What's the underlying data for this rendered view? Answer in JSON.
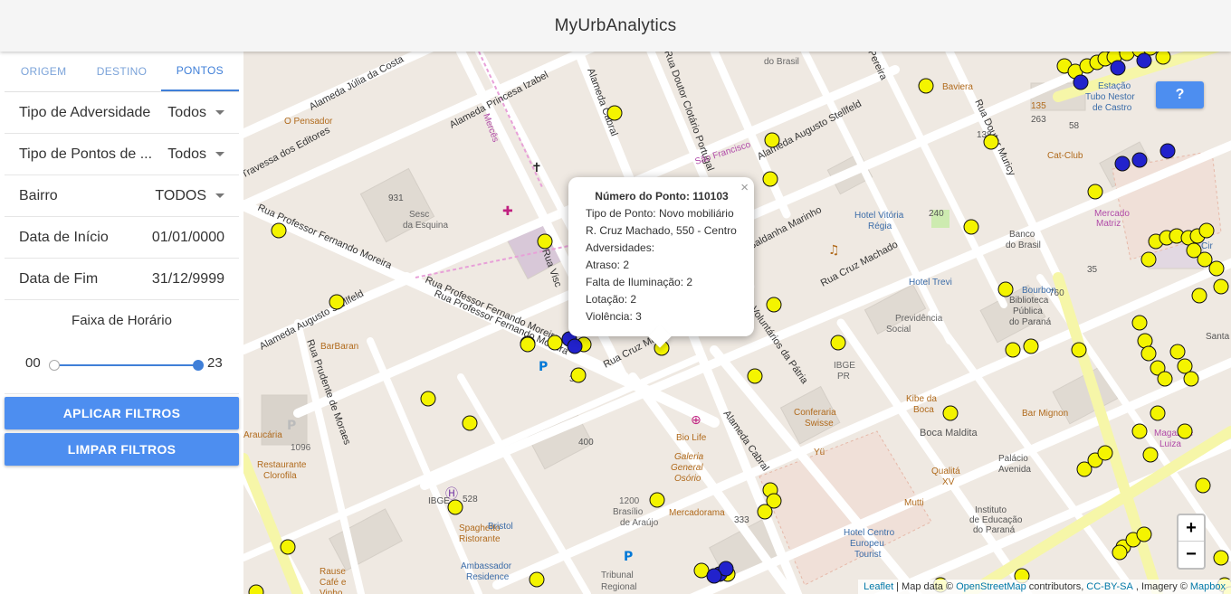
{
  "app": {
    "title": "MyUrbAnalytics"
  },
  "tabs": [
    {
      "label": "ORIGEM",
      "active": false
    },
    {
      "label": "DESTINO",
      "active": false
    },
    {
      "label": "PONTOS",
      "active": true
    }
  ],
  "filters": [
    {
      "label": "Tipo de Adversidade",
      "value": "Todos",
      "dropdown": true
    },
    {
      "label": "Tipo de Pontos de ...",
      "value": "Todos",
      "dropdown": true
    },
    {
      "label": "Bairro",
      "value": "TODOS",
      "dropdown": true
    },
    {
      "label": "Data de Início",
      "value": "01/01/0000",
      "dropdown": false
    },
    {
      "label": "Data de Fim",
      "value": "31/12/9999",
      "dropdown": false
    }
  ],
  "time_range": {
    "title": "Faixa de Horário",
    "min_label": "00",
    "max_label": "23",
    "min": 0,
    "max": 23
  },
  "buttons": {
    "apply": "APLICAR FILTROS",
    "clear": "LIMPAR FILTROS"
  },
  "popup": {
    "heading_label": "Número do Ponto:",
    "heading_value": "110103",
    "lines": [
      "Tipo de Ponto: Novo mobiliário",
      "R. Cruz Machado, 550 - Centro",
      "Adversidades:",
      "Atraso: 2",
      "Falta de Iluminação: 2",
      "Lotação: 2",
      "Violência: 3"
    ],
    "close": "×"
  },
  "help_button": "?",
  "zoom": {
    "in": "+",
    "out": "−"
  },
  "attribution": {
    "leaflet": "Leaflet",
    "sep1": "| Map data ©",
    "osm": "OpenStreetMap",
    "contrib": "contributors,",
    "license": "CC-BY-SA",
    "imagery": ", Imagery ©",
    "mapbox": "Mapbox"
  },
  "colors": {
    "primary": "#4d8ef0",
    "point_yellow": "#f4f400",
    "point_blue": "#2222cc",
    "map_bg": "#efe9e2"
  },
  "map_labels": [
    "Alameda Júlia da Costa",
    "Alameda Princesa Izabel",
    "Alameda Cabral",
    "Rua Doutor Clotário Portugal",
    "Travessa dos Editores",
    "Rua Professor Fernando Moreira",
    "Alameda Augusto Stellfeld",
    "Rua Cruz Machado",
    "Rua Saldanha Marinho",
    "Rua Prudente de Moraes",
    "Voluntários da Pátria",
    "Sesc da Esquina",
    "O Pensador",
    "BarBaran",
    "Restaurante Clorofila",
    "Espaghetto Ristorante",
    "Bristol",
    "IBGE",
    "Ambassador Residence",
    "Tribunal Regional",
    "Bio Life",
    "Galeria General Osório",
    "Mercadorama",
    "Conferaria Swisse",
    "Yü",
    "IBGE PR",
    "Hotel Vitória Régia",
    "Hotel Trevi",
    "Previdência Social",
    "Biblioteca Pública do Paraná",
    "Banco do Brasil",
    "Bourbon",
    "Kibe da Boca",
    "Boca Maldita",
    "Bar Mignon",
    "Palácio Avenida",
    "Qualitá XV",
    "Mutti",
    "Hotel Centro Europeu Tourist",
    "Instituto de Educação do Paraná",
    "Magazine Luiza",
    "Santa",
    "Cat-Club",
    "Estação Tubo Nestor de Castro",
    "Baviera",
    "Escoteiros do Brasil",
    "Mercês",
    "São Francisco",
    "Rause Café e Vinho",
    "Brasílio de Araújo",
    "Araucária",
    "Mercado Matriz",
    "Rua Visc",
    "Rua Cruz Machado",
    "Cir",
    "Rua Doutor Muricy",
    "Pereira"
  ],
  "points": {
    "yellow_count": 84,
    "blue_count": 11
  }
}
